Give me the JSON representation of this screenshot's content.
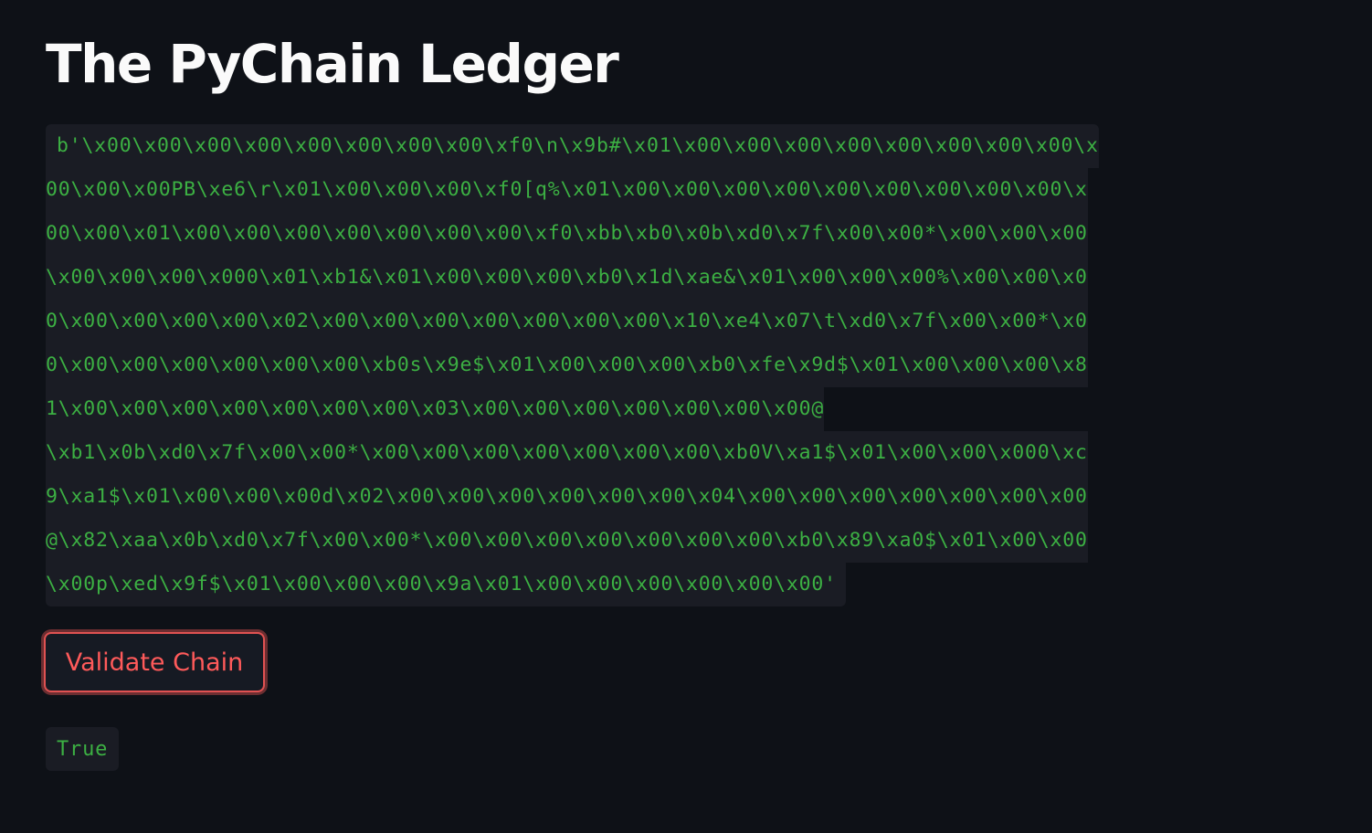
{
  "page": {
    "title": "The PyChain Ledger"
  },
  "ledger_output": {
    "lines": [
      "b'\\x00\\x00\\x00\\x00\\x00\\x00\\x00\\x00\\xf0\\n\\x9b#\\x01\\x00\\x00\\x00\\x00\\x00\\x00\\x00\\x00\\x",
      "00\\x00\\x00PB\\xe6\\r\\x01\\x00\\x00\\x00\\xf0[q%\\x01\\x00\\x00\\x00\\x00\\x00\\x00\\x00\\x00\\x00\\x",
      "00\\x00\\x01\\x00\\x00\\x00\\x00\\x00\\x00\\x00\\xf0\\xbb\\xb0\\x0b\\xd0\\x7f\\x00\\x00*\\x00\\x00\\x00",
      "\\x00\\x00\\x00\\x000\\x01\\xb1&\\x01\\x00\\x00\\x00\\xb0\\x1d\\xae&\\x01\\x00\\x00\\x00%\\x00\\x00\\x0",
      "0\\x00\\x00\\x00\\x00\\x02\\x00\\x00\\x00\\x00\\x00\\x00\\x00\\x10\\xe4\\x07\\t\\xd0\\x7f\\x00\\x00*\\x0",
      "0\\x00\\x00\\x00\\x00\\x00\\x00\\xb0s\\x9e$\\x01\\x00\\x00\\x00\\xb0\\xfe\\x9d$\\x01\\x00\\x00\\x00\\x8",
      "1\\x00\\x00\\x00\\x00\\x00\\x00\\x00\\x03\\x00\\x00\\x00\\x00\\x00\\x00\\x00@",
      "\\xb1\\x0b\\xd0\\x7f\\x00\\x00*\\x00\\x00\\x00\\x00\\x00\\x00\\x00\\xb0V\\xa1$\\x01\\x00\\x00\\x000\\xc",
      "9\\xa1$\\x01\\x00\\x00\\x00d\\x02\\x00\\x00\\x00\\x00\\x00\\x00\\x04\\x00\\x00\\x00\\x00\\x00\\x00\\x00",
      "@\\x82\\xaa\\x0b\\xd0\\x7f\\x00\\x00*\\x00\\x00\\x00\\x00\\x00\\x00\\x00\\xb0\\x89\\xa0$\\x01\\x00\\x00",
      "\\x00p\\xed\\x9f$\\x01\\x00\\x00\\x00\\x9a\\x01\\x00\\x00\\x00\\x00\\x00\\x00'"
    ]
  },
  "validate_button": {
    "label": "Validate Chain"
  },
  "validation_result": {
    "value": "True"
  },
  "colors": {
    "background": "#0e1117",
    "code_background": "#1a1c24",
    "code_text": "#3cb043",
    "button_accent": "#e05252"
  }
}
